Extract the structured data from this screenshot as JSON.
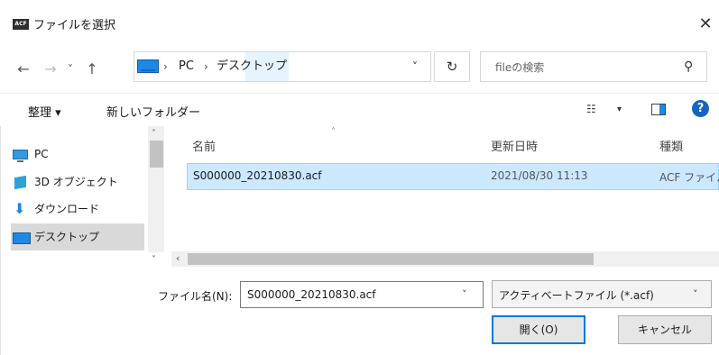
{
  "window": {
    "icon_text": "ACF",
    "title": "ファイルを選択",
    "close_glyph": "✕"
  },
  "navigation": {
    "back_glyph": "←",
    "forward_glyph": "→",
    "history_glyph": "˅",
    "up_glyph": "↑",
    "breadcrumb": [
      "PC",
      "デスクトップ"
    ],
    "separator": "›",
    "dropdown_glyph": "˅",
    "refresh_glyph": "↻",
    "search_placeholder": "fileの検索",
    "search_glyph": "⚲"
  },
  "toolbar": {
    "organize_label": "整理 ▾",
    "new_folder_label": "新しいフォルダー",
    "view_glyph": "☷",
    "view_caret": "▾",
    "help_glyph": "?"
  },
  "sidebar": {
    "items": [
      {
        "label": "PC",
        "icon": "pc-icon"
      },
      {
        "label": "3D オブジェクト",
        "icon": "3d-objects-icon"
      },
      {
        "label": "ダウンロード",
        "icon": "download-icon"
      },
      {
        "label": "デスクトップ",
        "icon": "desktop-icon",
        "selected": true
      }
    ],
    "scroll_up_glyph": "˄",
    "scroll_down_glyph": "˅"
  },
  "file_list": {
    "columns": [
      "名前",
      "更新日時",
      "種類"
    ],
    "sort_glyph": "˄",
    "rows": [
      {
        "name": "S000000_20210830.acf",
        "modified": "2021/08/30 11:13",
        "type": "ACF ファイル"
      }
    ],
    "hscroll_left_glyph": "‹"
  },
  "footer": {
    "filename_label": "ファイル名(N):",
    "filename_value": "S000000_20210830.acf",
    "filename_dd_glyph": "˅",
    "filetype_value": "アクティベートファイル (*.acf)",
    "filetype_dd_glyph": "˅",
    "open_label": "開く(O)",
    "cancel_label": "キャンセル"
  },
  "colors": {
    "accent": "#0078d7",
    "selection_bg": "#cce8ff",
    "selection_border": "#99d1ff",
    "help_blue": "#1565c0"
  }
}
